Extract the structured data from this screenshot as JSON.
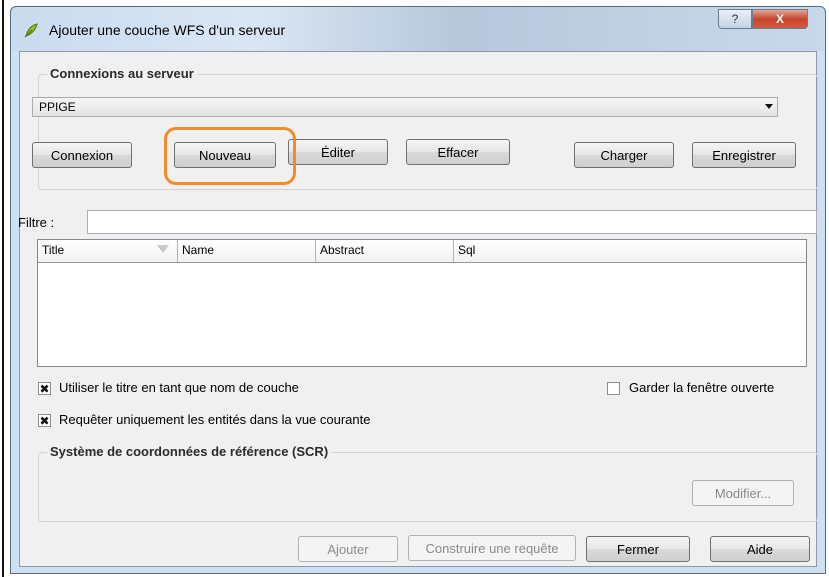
{
  "window": {
    "title": "Ajouter une couche WFS d'un serveur",
    "help_label": "?",
    "close_label": "X"
  },
  "connections": {
    "group_title": "Connexions au serveur",
    "selected": "PPIGE",
    "buttons": {
      "connect": "Connexion",
      "new": "Nouveau",
      "edit": "Éditer",
      "delete": "Effacer",
      "load": "Charger",
      "save": "Enregistrer"
    }
  },
  "filter": {
    "label": "Filtre :",
    "value": ""
  },
  "table": {
    "columns": [
      "Title",
      "Name",
      "Abstract",
      "Sql"
    ],
    "rows": []
  },
  "options": {
    "use_title": {
      "label": "Utiliser le titre en tant que nom de couche",
      "checked": true
    },
    "current_view": {
      "label": "Requêter uniquement les entités dans la vue courante",
      "checked": true
    },
    "keep_open": {
      "label": "Garder la fenêtre ouverte",
      "checked": false
    }
  },
  "crs": {
    "group_title": "Système de coordonnées de référence (SCR)",
    "modify_label": "Modifier..."
  },
  "footer": {
    "add": "Ajouter",
    "build_query": "Construire une requête",
    "close": "Fermer",
    "help": "Aide"
  },
  "colors": {
    "highlight": "#f28c28"
  },
  "icons": {
    "title": "qgis-leaf-icon",
    "sort": "sort-triangle-icon",
    "combo": "chevron-down-icon"
  }
}
